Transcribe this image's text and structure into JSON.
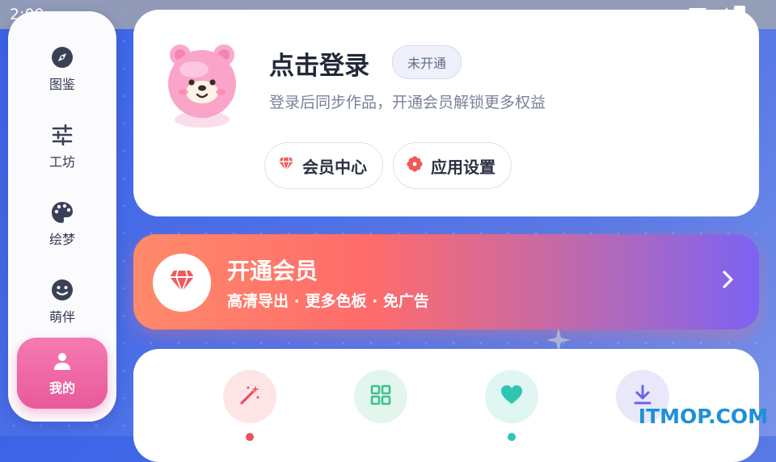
{
  "status_bar": {
    "time": "2:09",
    "icons": [
      "wifi-icon",
      "signal-icon",
      "battery-charging-icon"
    ]
  },
  "sidebar": {
    "items": [
      {
        "label": "图鉴",
        "icon": "compass-icon",
        "active": false
      },
      {
        "label": "工坊",
        "icon": "sliders-icon",
        "active": false
      },
      {
        "label": "绘梦",
        "icon": "palette-icon",
        "active": false
      },
      {
        "label": "萌伴",
        "icon": "smiley-icon",
        "active": false
      },
      {
        "label": "我的",
        "icon": "person-icon",
        "active": true
      }
    ]
  },
  "profile": {
    "title": "点击登录",
    "badge": "未开通",
    "subtitle": "登录后同步作品，开通会员解锁更多权益",
    "buttons": [
      {
        "label": "会员中心",
        "icon": "diamond-icon"
      },
      {
        "label": "应用设置",
        "icon": "flower-gear-icon"
      }
    ]
  },
  "vip_banner": {
    "title": "开通会员",
    "subtitle": "高清导出 · 更多色板 · 免广告",
    "icon": "diamond-icon"
  },
  "features": [
    {
      "icon": "magic-wand-icon",
      "color": "#e9515d",
      "bg": "#fde5e6"
    },
    {
      "icon": "grid-icon",
      "color": "#3cc18a",
      "bg": "#e3f6ee"
    },
    {
      "icon": "heart-icon",
      "color": "#2ec5b3",
      "bg": "#e0f6f3"
    },
    {
      "icon": "download-icon",
      "color": "#6b63e8",
      "bg": "#e9e8fb"
    }
  ],
  "colors": {
    "accent_pink": "#e9599a",
    "background_blue": "#3b63e6",
    "vip_gradient_start": "#ff8a6a",
    "vip_gradient_end": "#7c63f2"
  },
  "watermark": "ITMOP.COM"
}
